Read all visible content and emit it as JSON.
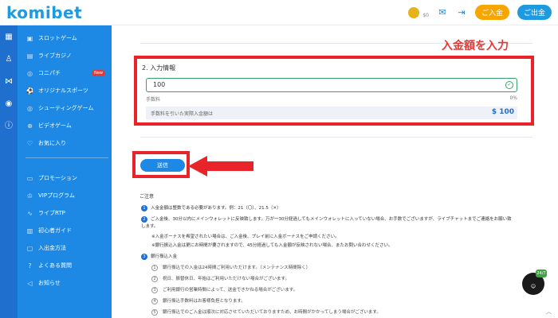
{
  "header": {
    "logo": "komibet",
    "balance": "$0",
    "deposit_label": "ご入金",
    "withdraw_label": "ご出金"
  },
  "sidebar": {
    "items": [
      {
        "label": "スロットゲーム",
        "icon": "slot-icon"
      },
      {
        "label": "ライブカジノ",
        "icon": "casino-icon"
      },
      {
        "label": "コニパチ",
        "icon": "pachinko-icon",
        "badge": "New"
      },
      {
        "label": "オリジナルスポーツ",
        "icon": "sports-icon"
      },
      {
        "label": "シューティングゲーム",
        "icon": "target-icon"
      },
      {
        "label": "ビデオゲーム",
        "icon": "gamepad-icon"
      },
      {
        "label": "お気に入り",
        "icon": "heart-icon"
      },
      {
        "label": "プロモーション",
        "icon": "gift-icon"
      },
      {
        "label": "VIPプログラム",
        "icon": "crown-icon"
      },
      {
        "label": "ライブRTP",
        "icon": "chart-icon"
      },
      {
        "label": "初心者ガイド",
        "icon": "book-icon"
      },
      {
        "label": "入出金方法",
        "icon": "wallet-icon"
      },
      {
        "label": "よくある質問",
        "icon": "question-icon"
      },
      {
        "label": "お知らせ",
        "icon": "megaphone-icon"
      }
    ]
  },
  "annotation": {
    "callout": "入金額を入力",
    "accent": "#e8242a"
  },
  "form": {
    "section_title": "2. 入力情報",
    "amount_value": "100",
    "fee_label": "手数料",
    "fee_value": "0%",
    "actual_label": "手数料を引いた実際入金額は",
    "actual_value": "$ 100",
    "submit_label": "送信"
  },
  "notes": {
    "title": "ご注意",
    "items": [
      {
        "num": "1",
        "text": "入金金額は整数である必要があります。例：21（〇）、21.5（✕）"
      },
      {
        "num": "2",
        "text": "ご入金後、30分以内にメインウォレットに反映致します。万が一30分経過してもメインウォレットに入っていない場合、お手数でございますが、ライブチャットまでご連絡をお願い致します。"
      },
      {
        "num": "",
        "text": "※入金ボーナスを希望されたい場合は、ご入金後、プレイ前に入金ボーナスをご申請ください。"
      },
      {
        "num": "",
        "text": "※銀行振込入金は更にお時間が要されますので、45分経過しても入金額が反映されない場合、またお問い合わせください。"
      },
      {
        "num": "3",
        "text": "銀行振込入金"
      }
    ],
    "bank_items": [
      {
        "num": "1",
        "text": "銀行振込での入金は24時間ご利用いただけます。（メンテナンス時間除く）"
      },
      {
        "num": "2",
        "text": "祝日、振替休日、年始はご利用いただけない場合がございます。"
      },
      {
        "num": "3",
        "text": "ご利用銀行の営業時間によって、送金できかねる場合がございます。"
      },
      {
        "num": "4",
        "text": "銀行振込手数料はお客様負担となります。"
      },
      {
        "num": "5",
        "text": "銀行振込でのご入金は順次に対応させていただいておりますため、お時間がかかってしまう場合がございます。"
      }
    ]
  },
  "chat_badge": "24/7",
  "colors": {
    "primary": "#1e88e5",
    "rail": "#1e6fce",
    "deposit": "#f7a600",
    "highlight": "#e8242a"
  }
}
